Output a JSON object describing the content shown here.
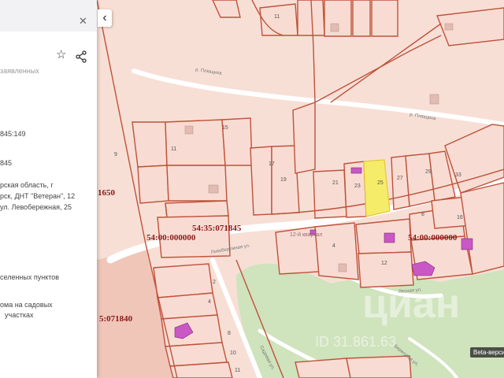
{
  "panel": {
    "close_icon": "close-icon",
    "star_icon": "star-icon",
    "share_icon": "share-icon",
    "lines": [
      {
        "text": "заявленных"
      },
      {
        "text": "845:149"
      },
      {
        "text": "845"
      },
      {
        "text": "рская область, г"
      },
      {
        "text": "рск, ДНТ \"Ветеран\", 12"
      },
      {
        "text": "ул. Левобережная, 25"
      },
      {
        "text": "селенных пунктов"
      },
      {
        "text": "ома на садовых"
      },
      {
        "text": "участках"
      }
    ]
  },
  "collapse_icon": "chevron-left-icon",
  "map": {
    "colors": {
      "background": "#f7dfd6",
      "parcel_fill": "#f8dcd3",
      "boundary": "#c0523a",
      "road": "#ffffff",
      "green_area": "#cfe3bd",
      "highlight": "#f5ec6a",
      "building": "#c957c4",
      "cadastral_label": "#8b1a1a"
    },
    "street_labels": [
      {
        "text": "р. Плющиха"
      },
      {
        "text": "р. Плющиха"
      },
      {
        "text": "Левобережная ул."
      },
      {
        "text": "Лесная ул."
      },
      {
        "text": "Садовая ул."
      },
      {
        "text": "Береговая ул."
      }
    ],
    "cadastral_labels": [
      {
        "text": "54:35:071845"
      },
      {
        "text": "54:00:000000"
      },
      {
        "text": "54:00:000000"
      },
      {
        "text": "1650"
      },
      {
        "text": "5:071840"
      }
    ],
    "quarter_label": "12-й квартал",
    "parcel_numbers": [
      "11",
      "15",
      "11",
      "17",
      "19",
      "9",
      "21",
      "23",
      "25",
      "27",
      "29",
      "33",
      "8",
      "16",
      "4",
      "12",
      "2",
      "4",
      "8",
      "10",
      "11"
    ],
    "beta_label": "Beta-версия",
    "watermark": "циан",
    "watermark_id": "ID 31.861.63"
  }
}
